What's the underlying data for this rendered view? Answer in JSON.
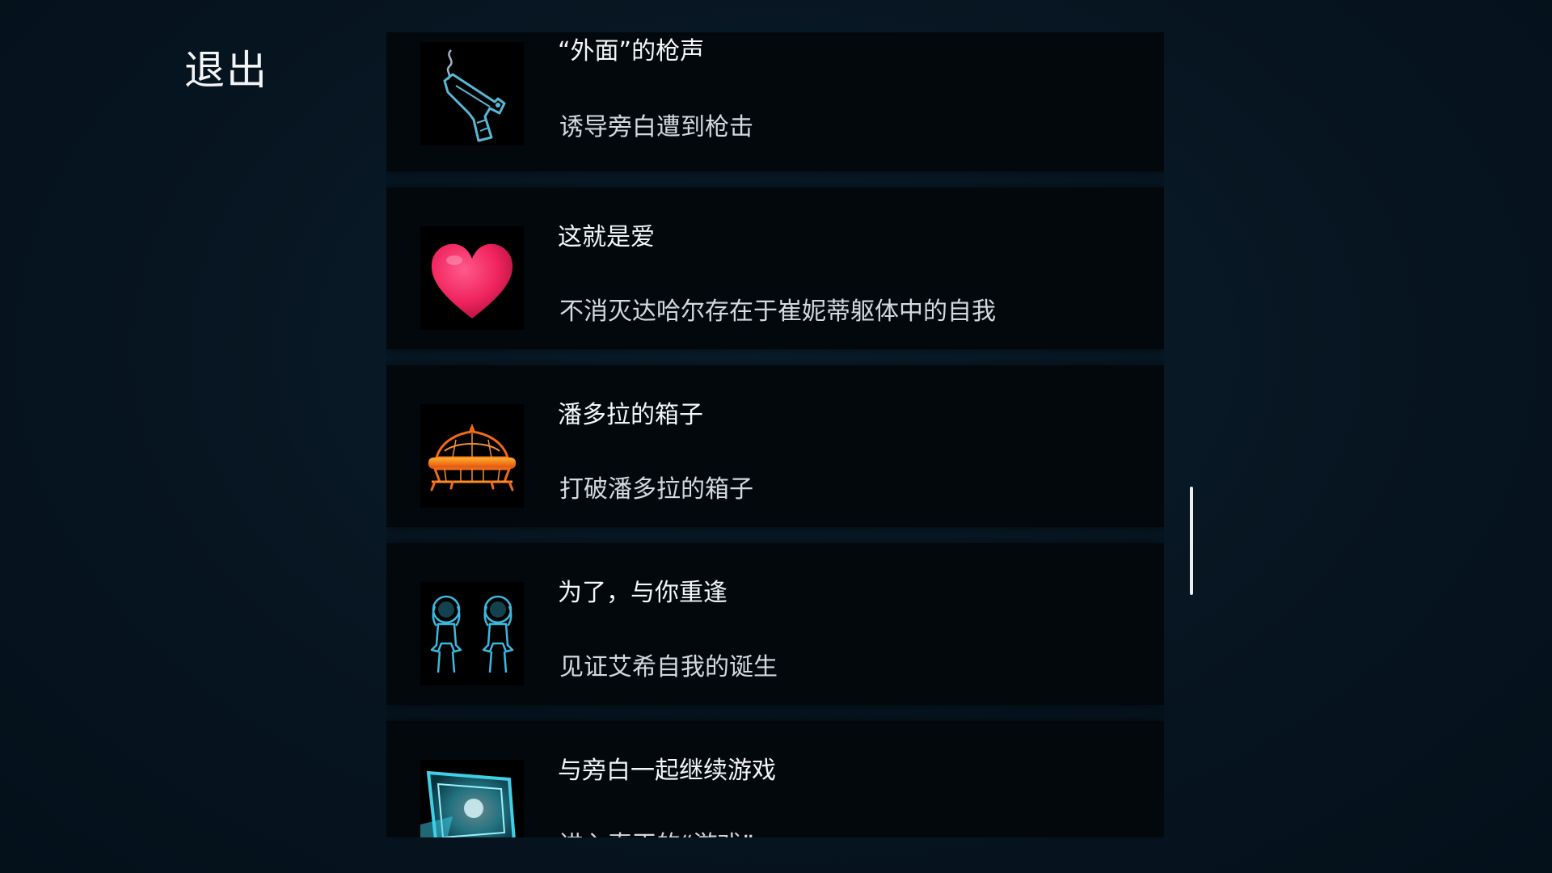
{
  "exit_label": "退出",
  "achievements": [
    {
      "title": "“外面”的枪声",
      "description": "诱导旁白遭到枪击",
      "icon": "pistol-icon",
      "icon_color": "#58b8d8"
    },
    {
      "title": "这就是爱",
      "description": "不消灭达哈尔存在于崔妮蒂躯体中的自我",
      "icon": "heart-icon",
      "icon_color": "#f0245f"
    },
    {
      "title": "潘多拉的箱子",
      "description": "打破潘多拉的箱子",
      "icon": "pandora-box-icon",
      "icon_color": "#f06a1a"
    },
    {
      "title": "为了，与你重逢",
      "description": "见证艾希自我的诞生",
      "icon": "twin-girls-icon",
      "icon_color": "#3bb9df"
    },
    {
      "title": "与旁白一起继续游戏",
      "description": "进入真正的“游戏”",
      "icon": "monitor-icon",
      "icon_color": "#3fd0e8"
    }
  ],
  "colors": {
    "background": "#071521",
    "card": "#03080d",
    "title_text": "#f4f6f8",
    "description_text": "#d3d9de",
    "scrollbar": "#e8eef2"
  }
}
